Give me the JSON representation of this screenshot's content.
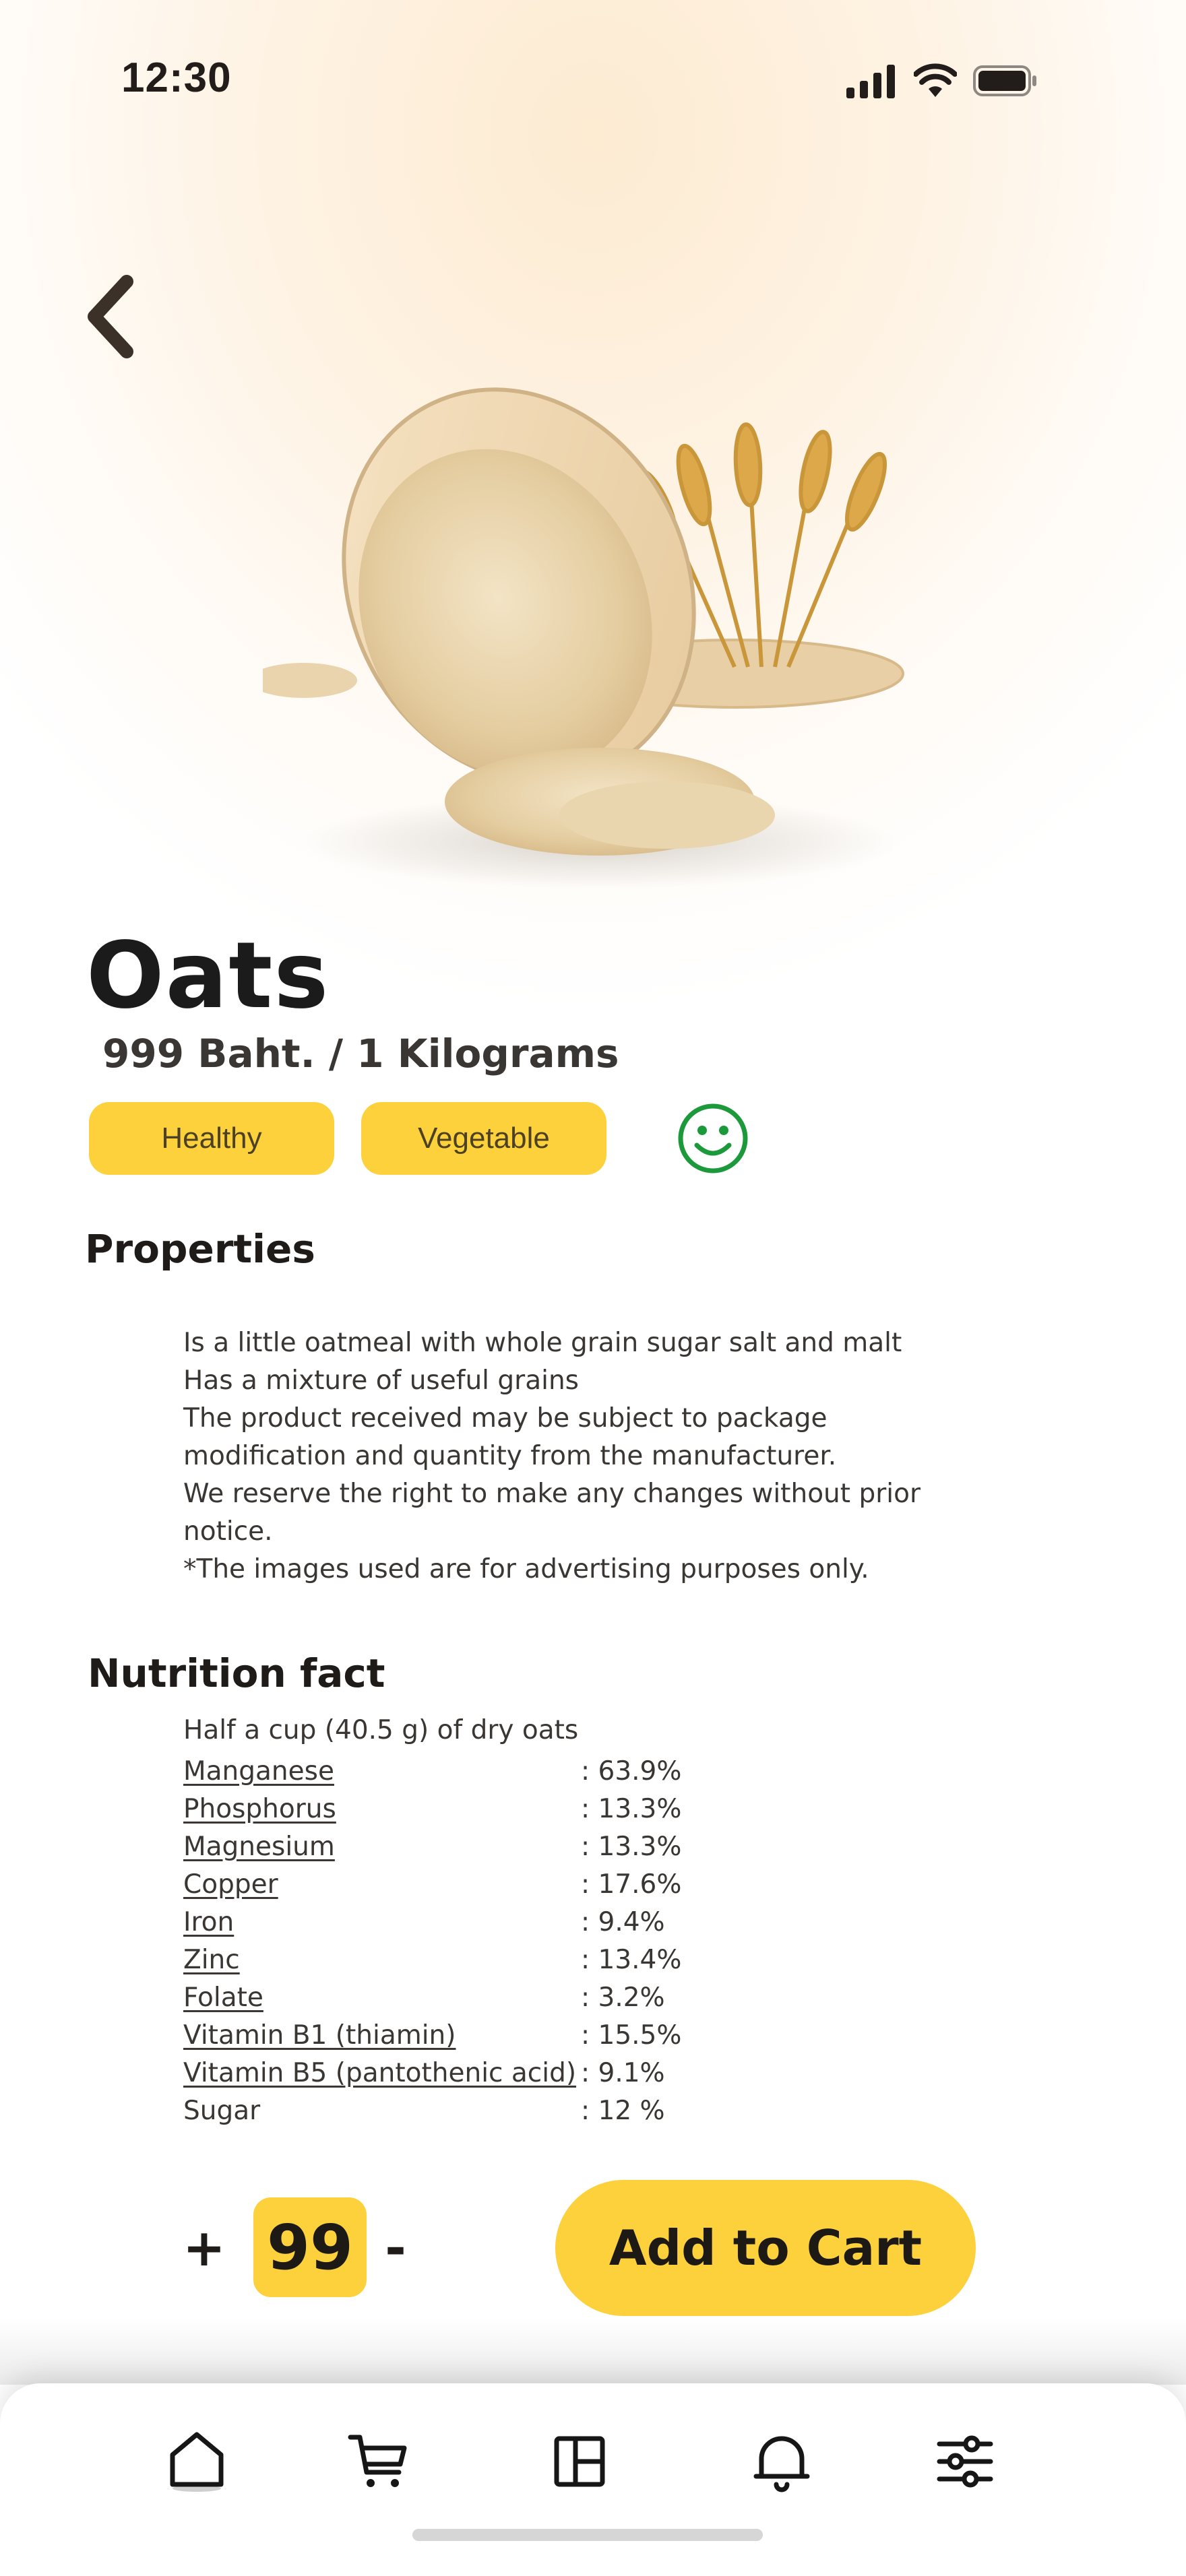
{
  "status_bar": {
    "time": "12:30"
  },
  "product": {
    "name": "Oats",
    "price": "999 Baht.  / 1 Kilograms",
    "tags": [
      "Healthy",
      "Vegetable"
    ]
  },
  "properties": {
    "heading": "Properties",
    "lines": [
      "Is a little oatmeal with whole grain sugar salt and malt",
      "Has a mixture of useful grains",
      "The product received may be subject to package",
      "modification and quantity from the manufacturer.",
      "We reserve the right to make any changes without prior",
      "notice.",
      "*The images used are for advertising purposes only."
    ]
  },
  "nutrition": {
    "heading": "Nutrition fact",
    "serving": "Half a cup (40.5 g) of dry oats",
    "items": [
      {
        "name": "Manganese",
        "value": ": 63.9%"
      },
      {
        "name": "Phosphorus",
        "value": ": 13.3%"
      },
      {
        "name": "Magnesium",
        "value": ": 13.3%"
      },
      {
        "name": "Copper",
        "value": ": 17.6%"
      },
      {
        "name": "Iron",
        "value": ": 9.4%"
      },
      {
        "name": "Zinc",
        "value": ": 13.4%"
      },
      {
        "name": "Folate",
        "value": ": 3.2%"
      },
      {
        "name": "Vitamin B1 (thiamin)",
        "value": ": 15.5%"
      },
      {
        "name": "Vitamin B5 (pantothenic acid)",
        "value": ": 9.1%"
      },
      {
        "name": "Sugar",
        "value": ": 12 %"
      }
    ]
  },
  "cart": {
    "plus_label": "+",
    "quantity": "99",
    "minus_label": "-",
    "add_label": "Add to Cart"
  },
  "icons": {
    "back": "chevron-left-icon",
    "mood": "smiley-icon",
    "tabs": [
      "home-icon",
      "cart-icon",
      "layout-icon",
      "bell-icon",
      "filter-sliders-icon"
    ]
  },
  "colors": {
    "accent": "#fdd13c",
    "smiley": "#1c9a3b",
    "text": "#2b2724"
  }
}
